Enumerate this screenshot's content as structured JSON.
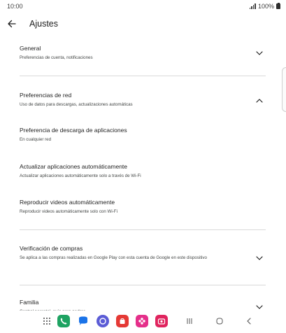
{
  "status_bar": {
    "time": "10:00",
    "battery": "100%"
  },
  "header": {
    "title": "Ajustes"
  },
  "sections": {
    "general": {
      "title": "General",
      "subtitle": "Preferencias de cuenta, notificaciones"
    },
    "red": {
      "title": "Preferencias de red",
      "subtitle": "Uso de datos para descargas, actualizaciones automáticas"
    },
    "descarga": {
      "title": "Preferencia de descarga de aplicaciones",
      "subtitle": "En cualquier red"
    },
    "actualizar": {
      "title": "Actualizar aplicaciones automáticamente",
      "subtitle": "Actualizar aplicaciones automáticamente solo a través de Wi-Fi"
    },
    "videos": {
      "title": "Reproducir videos automáticamente",
      "subtitle": "Reproducir videos automáticamente solo con Wi-Fi"
    },
    "compras": {
      "title": "Verificación de compras",
      "subtitle": "Se aplica a las compras realizadas en Google Play con esta cuenta de Google en este dispositivo"
    },
    "familia": {
      "title": "Familia",
      "subtitle": "Control parental, guía para padres"
    }
  },
  "colors": {
    "apps_phone": "#1ea362",
    "messages": "#1a73e8",
    "internet": "#5b5cd6",
    "store": "#e53935",
    "blossom": "#e52f8a",
    "camera": "#e0245e"
  },
  "icons": [
    "back-arrow-icon",
    "chevron-down-icon",
    "chevron-up-icon",
    "apps-grid-icon",
    "recents-icon",
    "home-icon",
    "nav-back-icon"
  ]
}
